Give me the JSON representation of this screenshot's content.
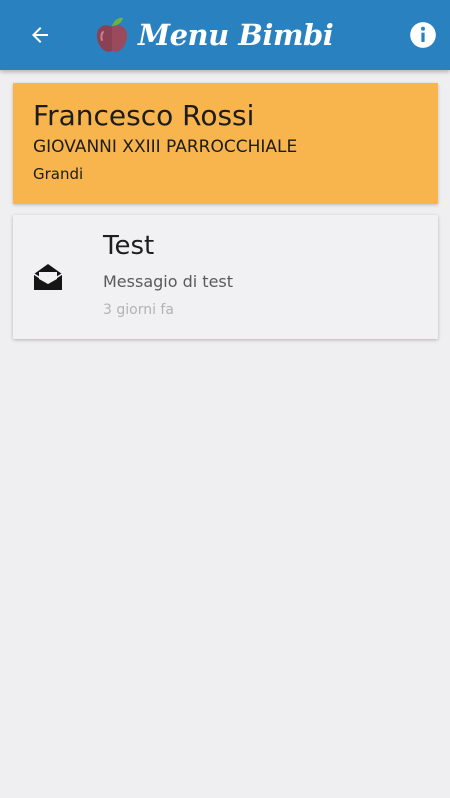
{
  "appbar": {
    "title": "Menu Bimbi",
    "back_icon": "arrow-left-icon",
    "info_icon": "info-circle-icon",
    "background": "#2a81c0"
  },
  "profile": {
    "name": "Francesco Rossi",
    "school": "GIOVANNI XXIII PARROCCHIALE",
    "group": "Grandi",
    "background": "#f8b44d"
  },
  "messages": [
    {
      "icon": "envelope-open-icon",
      "title": "Test",
      "body": "Messagio di test",
      "time": "3 giorni fa"
    }
  ]
}
